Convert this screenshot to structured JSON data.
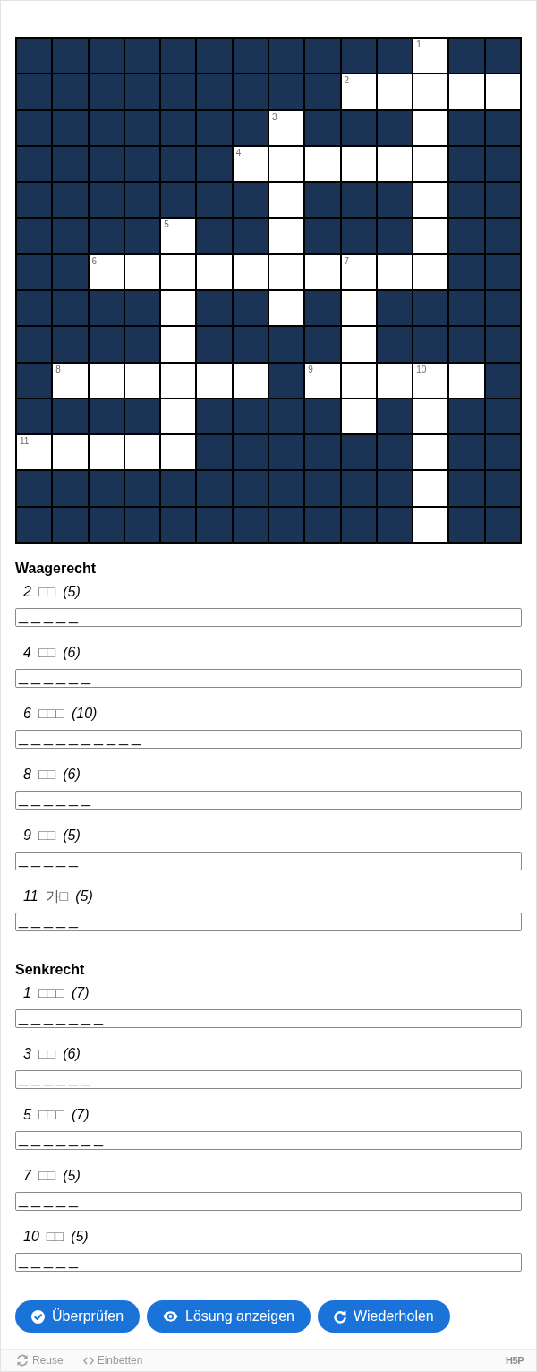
{
  "grid": {
    "rows": [
      [
        {
          "kind": "block"
        },
        {
          "kind": "block"
        },
        {
          "kind": "block"
        },
        {
          "kind": "block"
        },
        {
          "kind": "block"
        },
        {
          "kind": "block"
        },
        {
          "kind": "block"
        },
        {
          "kind": "block"
        },
        {
          "kind": "block"
        },
        {
          "kind": "block"
        },
        {
          "kind": "block"
        },
        {
          "kind": "letter",
          "number": "1"
        },
        {
          "kind": "block"
        },
        {
          "kind": "block"
        }
      ],
      [
        {
          "kind": "block"
        },
        {
          "kind": "block"
        },
        {
          "kind": "block"
        },
        {
          "kind": "block"
        },
        {
          "kind": "block"
        },
        {
          "kind": "block"
        },
        {
          "kind": "block"
        },
        {
          "kind": "block"
        },
        {
          "kind": "block"
        },
        {
          "kind": "letter",
          "number": "2"
        },
        {
          "kind": "letter"
        },
        {
          "kind": "letter"
        },
        {
          "kind": "letter"
        },
        {
          "kind": "letter"
        }
      ],
      [
        {
          "kind": "block"
        },
        {
          "kind": "block"
        },
        {
          "kind": "block"
        },
        {
          "kind": "block"
        },
        {
          "kind": "block"
        },
        {
          "kind": "block"
        },
        {
          "kind": "block"
        },
        {
          "kind": "letter",
          "number": "3"
        },
        {
          "kind": "block"
        },
        {
          "kind": "block"
        },
        {
          "kind": "block"
        },
        {
          "kind": "letter"
        },
        {
          "kind": "block"
        },
        {
          "kind": "block"
        }
      ],
      [
        {
          "kind": "block"
        },
        {
          "kind": "block"
        },
        {
          "kind": "block"
        },
        {
          "kind": "block"
        },
        {
          "kind": "block"
        },
        {
          "kind": "block"
        },
        {
          "kind": "letter",
          "number": "4"
        },
        {
          "kind": "letter"
        },
        {
          "kind": "letter"
        },
        {
          "kind": "letter"
        },
        {
          "kind": "letter"
        },
        {
          "kind": "letter"
        },
        {
          "kind": "block"
        },
        {
          "kind": "block"
        }
      ],
      [
        {
          "kind": "block"
        },
        {
          "kind": "block"
        },
        {
          "kind": "block"
        },
        {
          "kind": "block"
        },
        {
          "kind": "block"
        },
        {
          "kind": "block"
        },
        {
          "kind": "block"
        },
        {
          "kind": "letter"
        },
        {
          "kind": "block"
        },
        {
          "kind": "block"
        },
        {
          "kind": "block"
        },
        {
          "kind": "letter"
        },
        {
          "kind": "block"
        },
        {
          "kind": "block"
        }
      ],
      [
        {
          "kind": "block"
        },
        {
          "kind": "block"
        },
        {
          "kind": "block"
        },
        {
          "kind": "block"
        },
        {
          "kind": "letter",
          "number": "5"
        },
        {
          "kind": "block"
        },
        {
          "kind": "block"
        },
        {
          "kind": "letter"
        },
        {
          "kind": "block"
        },
        {
          "kind": "block"
        },
        {
          "kind": "block"
        },
        {
          "kind": "letter"
        },
        {
          "kind": "block"
        },
        {
          "kind": "block"
        }
      ],
      [
        {
          "kind": "block"
        },
        {
          "kind": "block"
        },
        {
          "kind": "letter",
          "number": "6"
        },
        {
          "kind": "letter"
        },
        {
          "kind": "letter"
        },
        {
          "kind": "letter"
        },
        {
          "kind": "letter"
        },
        {
          "kind": "letter"
        },
        {
          "kind": "letter"
        },
        {
          "kind": "letter",
          "number": "7"
        },
        {
          "kind": "letter"
        },
        {
          "kind": "letter"
        },
        {
          "kind": "block"
        },
        {
          "kind": "block"
        }
      ],
      [
        {
          "kind": "block"
        },
        {
          "kind": "block"
        },
        {
          "kind": "block"
        },
        {
          "kind": "block"
        },
        {
          "kind": "letter"
        },
        {
          "kind": "block"
        },
        {
          "kind": "block"
        },
        {
          "kind": "letter"
        },
        {
          "kind": "block"
        },
        {
          "kind": "letter"
        },
        {
          "kind": "block"
        },
        {
          "kind": "block"
        },
        {
          "kind": "block"
        },
        {
          "kind": "block"
        }
      ],
      [
        {
          "kind": "block"
        },
        {
          "kind": "block"
        },
        {
          "kind": "block"
        },
        {
          "kind": "block"
        },
        {
          "kind": "letter"
        },
        {
          "kind": "block"
        },
        {
          "kind": "block"
        },
        {
          "kind": "block"
        },
        {
          "kind": "block"
        },
        {
          "kind": "letter"
        },
        {
          "kind": "block"
        },
        {
          "kind": "block"
        },
        {
          "kind": "block"
        },
        {
          "kind": "block"
        }
      ],
      [
        {
          "kind": "block"
        },
        {
          "kind": "letter",
          "number": "8"
        },
        {
          "kind": "letter"
        },
        {
          "kind": "letter"
        },
        {
          "kind": "letter"
        },
        {
          "kind": "letter"
        },
        {
          "kind": "letter"
        },
        {
          "kind": "block"
        },
        {
          "kind": "letter",
          "number": "9"
        },
        {
          "kind": "letter"
        },
        {
          "kind": "letter"
        },
        {
          "kind": "letter",
          "number": "10"
        },
        {
          "kind": "letter"
        },
        {
          "kind": "block"
        }
      ],
      [
        {
          "kind": "block"
        },
        {
          "kind": "block"
        },
        {
          "kind": "block"
        },
        {
          "kind": "block"
        },
        {
          "kind": "letter"
        },
        {
          "kind": "block"
        },
        {
          "kind": "block"
        },
        {
          "kind": "block"
        },
        {
          "kind": "block"
        },
        {
          "kind": "letter"
        },
        {
          "kind": "block"
        },
        {
          "kind": "letter"
        },
        {
          "kind": "block"
        },
        {
          "kind": "block"
        }
      ],
      [
        {
          "kind": "letter",
          "number": "11"
        },
        {
          "kind": "letter"
        },
        {
          "kind": "letter"
        },
        {
          "kind": "letter"
        },
        {
          "kind": "letter"
        },
        {
          "kind": "block"
        },
        {
          "kind": "block"
        },
        {
          "kind": "block"
        },
        {
          "kind": "block"
        },
        {
          "kind": "block"
        },
        {
          "kind": "block"
        },
        {
          "kind": "letter"
        },
        {
          "kind": "block"
        },
        {
          "kind": "block"
        }
      ],
      [
        {
          "kind": "block"
        },
        {
          "kind": "block"
        },
        {
          "kind": "block"
        },
        {
          "kind": "block"
        },
        {
          "kind": "block"
        },
        {
          "kind": "block"
        },
        {
          "kind": "block"
        },
        {
          "kind": "block"
        },
        {
          "kind": "block"
        },
        {
          "kind": "block"
        },
        {
          "kind": "block"
        },
        {
          "kind": "letter"
        },
        {
          "kind": "block"
        },
        {
          "kind": "block"
        }
      ],
      [
        {
          "kind": "block"
        },
        {
          "kind": "block"
        },
        {
          "kind": "block"
        },
        {
          "kind": "block"
        },
        {
          "kind": "block"
        },
        {
          "kind": "block"
        },
        {
          "kind": "block"
        },
        {
          "kind": "block"
        },
        {
          "kind": "block"
        },
        {
          "kind": "block"
        },
        {
          "kind": "block"
        },
        {
          "kind": "letter"
        },
        {
          "kind": "block"
        },
        {
          "kind": "block"
        }
      ]
    ]
  },
  "clue_sections": [
    {
      "heading": "Waagerecht",
      "clues": [
        {
          "number": "2",
          "clue": "□□",
          "length": "(5)",
          "value": "_____"
        },
        {
          "number": "4",
          "clue": "□□",
          "length": "(6)",
          "value": "______"
        },
        {
          "number": "6",
          "clue": "□□□",
          "length": "(10)",
          "value": "__________"
        },
        {
          "number": "8",
          "clue": "□□",
          "length": "(6)",
          "value": "______"
        },
        {
          "number": "9",
          "clue": "□□",
          "length": "(5)",
          "value": "_____"
        },
        {
          "number": "11",
          "clue": "가□",
          "length": "(5)",
          "value": "_____"
        }
      ]
    },
    {
      "heading": "Senkrecht",
      "clues": [
        {
          "number": "1",
          "clue": "□□□",
          "length": "(7)",
          "value": "_______"
        },
        {
          "number": "3",
          "clue": "□□",
          "length": "(6)",
          "value": "______"
        },
        {
          "number": "5",
          "clue": "□□□",
          "length": "(7)",
          "value": "_______"
        },
        {
          "number": "7",
          "clue": "□□",
          "length": "(5)",
          "value": "_____"
        },
        {
          "number": "10",
          "clue": "□□",
          "length": "(5)",
          "value": "_____"
        }
      ]
    }
  ],
  "buttons": [
    {
      "kind": "check",
      "label": "Überprüfen"
    },
    {
      "kind": "solution",
      "label": "Lösung anzeigen"
    },
    {
      "kind": "retry",
      "label": "Wiederholen"
    }
  ],
  "footer": {
    "links": [
      {
        "kind": "reuse",
        "label": "Reuse"
      },
      {
        "kind": "embed",
        "label": "Einbetten"
      }
    ],
    "logo": "H5P"
  }
}
